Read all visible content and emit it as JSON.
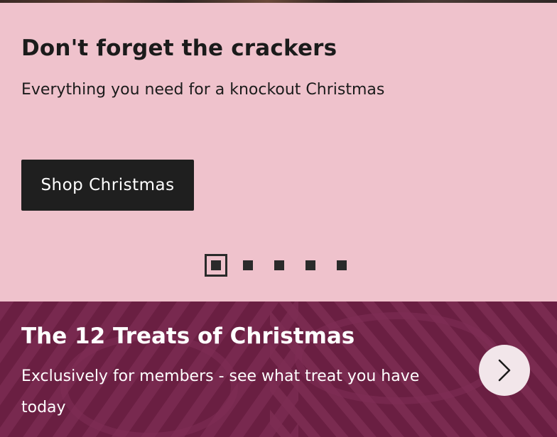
{
  "promo": {
    "title": "Don't forget the crackers",
    "subtitle": "Everything you need for a knockout Christmas",
    "button_label": "Shop Christmas",
    "background_color": "#efc2cc",
    "button_color": "#1f1f1f"
  },
  "carousel": {
    "total_slides": 5,
    "active_slide": 1
  },
  "members_banner": {
    "title": "The 12 Treats of Christmas",
    "text": "Exclusively for members - see what treat you have today",
    "next_icon": "chevron-right-icon",
    "background_color": "#6e2145"
  }
}
